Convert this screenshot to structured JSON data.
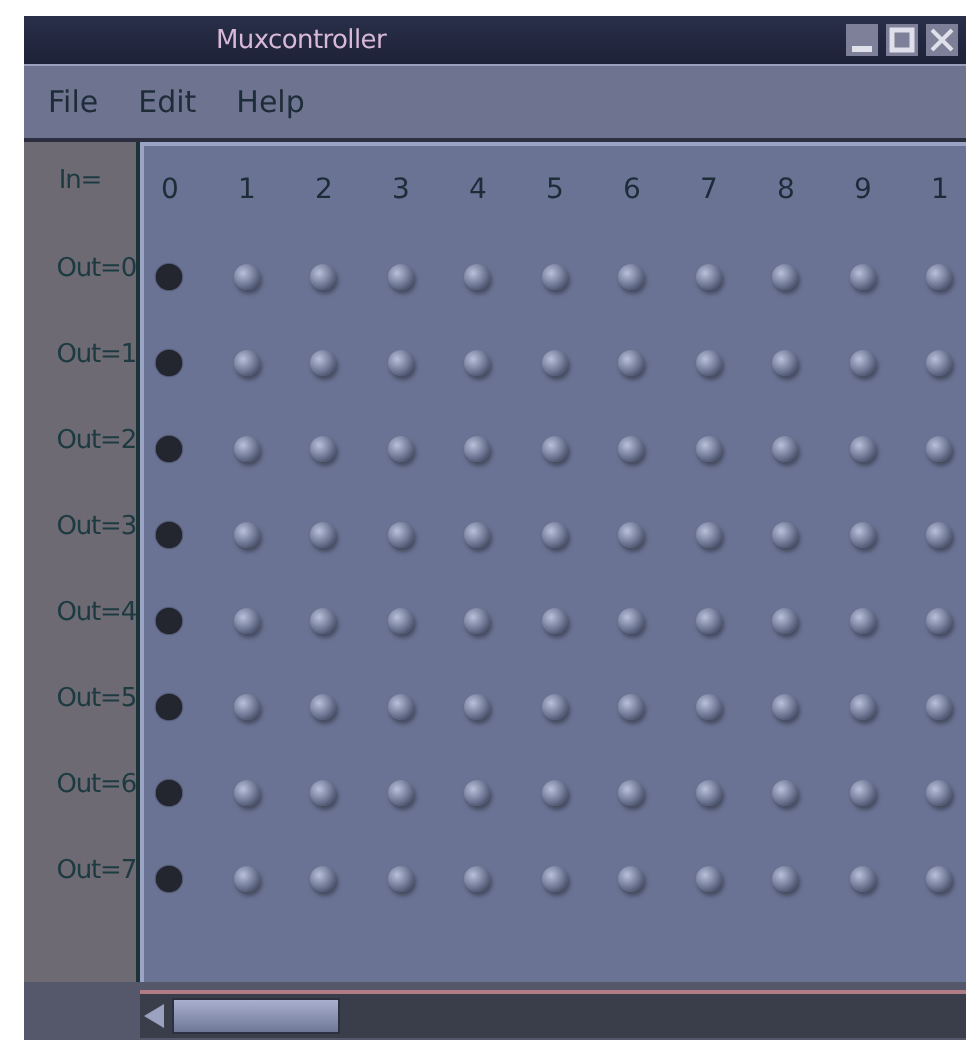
{
  "window": {
    "title": "Muxcontroller"
  },
  "menu": [
    "File",
    "Edit",
    "Help"
  ],
  "corner_label": "In=",
  "columns": [
    "0",
    "1",
    "2",
    "3",
    "4",
    "5",
    "6",
    "7",
    "8",
    "9",
    "1"
  ],
  "rows": [
    {
      "label": "Out=0",
      "cells": [
        {
          "selected": true
        },
        {
          "selected": false
        },
        {
          "selected": false
        },
        {
          "selected": false
        },
        {
          "selected": false
        },
        {
          "selected": false
        },
        {
          "selected": false
        },
        {
          "selected": false
        },
        {
          "selected": false
        },
        {
          "selected": false
        },
        {
          "selected": false
        }
      ]
    },
    {
      "label": "Out=1",
      "cells": [
        {
          "selected": true
        },
        {
          "selected": false
        },
        {
          "selected": false
        },
        {
          "selected": false
        },
        {
          "selected": false
        },
        {
          "selected": false
        },
        {
          "selected": false
        },
        {
          "selected": false
        },
        {
          "selected": false
        },
        {
          "selected": false
        },
        {
          "selected": false
        }
      ]
    },
    {
      "label": "Out=2",
      "cells": [
        {
          "selected": true
        },
        {
          "selected": false
        },
        {
          "selected": false
        },
        {
          "selected": false
        },
        {
          "selected": false
        },
        {
          "selected": false
        },
        {
          "selected": false
        },
        {
          "selected": false
        },
        {
          "selected": false
        },
        {
          "selected": false
        },
        {
          "selected": false
        }
      ]
    },
    {
      "label": "Out=3",
      "cells": [
        {
          "selected": true
        },
        {
          "selected": false
        },
        {
          "selected": false
        },
        {
          "selected": false
        },
        {
          "selected": false
        },
        {
          "selected": false
        },
        {
          "selected": false
        },
        {
          "selected": false
        },
        {
          "selected": false
        },
        {
          "selected": false
        },
        {
          "selected": false
        }
      ]
    },
    {
      "label": "Out=4",
      "cells": [
        {
          "selected": true
        },
        {
          "selected": false
        },
        {
          "selected": false
        },
        {
          "selected": false
        },
        {
          "selected": false
        },
        {
          "selected": false
        },
        {
          "selected": false
        },
        {
          "selected": false
        },
        {
          "selected": false
        },
        {
          "selected": false
        },
        {
          "selected": false
        }
      ]
    },
    {
      "label": "Out=5",
      "cells": [
        {
          "selected": true
        },
        {
          "selected": false
        },
        {
          "selected": false
        },
        {
          "selected": false
        },
        {
          "selected": false
        },
        {
          "selected": false
        },
        {
          "selected": false
        },
        {
          "selected": false
        },
        {
          "selected": false
        },
        {
          "selected": false
        },
        {
          "selected": false
        }
      ]
    },
    {
      "label": "Out=6",
      "cells": [
        {
          "selected": true
        },
        {
          "selected": false
        },
        {
          "selected": false
        },
        {
          "selected": false
        },
        {
          "selected": false
        },
        {
          "selected": false
        },
        {
          "selected": false
        },
        {
          "selected": false
        },
        {
          "selected": false
        },
        {
          "selected": false
        },
        {
          "selected": false
        }
      ]
    },
    {
      "label": "Out=7",
      "cells": [
        {
          "selected": true
        },
        {
          "selected": false
        },
        {
          "selected": false
        },
        {
          "selected": false
        },
        {
          "selected": false
        },
        {
          "selected": false
        },
        {
          "selected": false
        },
        {
          "selected": false
        },
        {
          "selected": false
        },
        {
          "selected": false
        },
        {
          "selected": false
        }
      ]
    }
  ]
}
